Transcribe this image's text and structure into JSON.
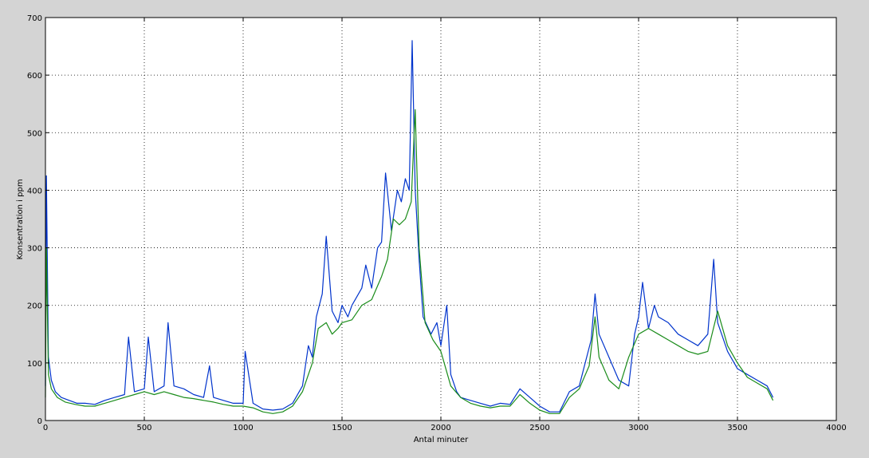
{
  "chart_data": {
    "type": "line",
    "title": "",
    "xlabel": "Antal minuter",
    "ylabel": "Konsentration i ppm",
    "xlim": [
      0,
      4000
    ],
    "ylim": [
      0,
      700
    ],
    "xticks": [
      0,
      500,
      1000,
      1500,
      2000,
      2500,
      3000,
      3500,
      4000
    ],
    "yticks": [
      0,
      100,
      200,
      300,
      400,
      500,
      600,
      700
    ],
    "grid": true,
    "legend": "none",
    "series": [
      {
        "color": "#0033cc",
        "x": [
          0,
          5,
          15,
          30,
          50,
          80,
          120,
          160,
          200,
          250,
          300,
          350,
          400,
          420,
          450,
          500,
          520,
          550,
          600,
          620,
          650,
          700,
          750,
          800,
          830,
          850,
          900,
          950,
          1000,
          1010,
          1050,
          1100,
          1150,
          1200,
          1250,
          1300,
          1330,
          1350,
          1370,
          1400,
          1420,
          1450,
          1480,
          1500,
          1530,
          1550,
          1600,
          1620,
          1650,
          1680,
          1700,
          1720,
          1750,
          1780,
          1800,
          1820,
          1840,
          1855,
          1870,
          1890,
          1910,
          1950,
          1980,
          2000,
          2030,
          2050,
          2080,
          2100,
          2150,
          2200,
          2250,
          2300,
          2350,
          2400,
          2450,
          2500,
          2550,
          2600,
          2650,
          2700,
          2730,
          2760,
          2780,
          2800,
          2850,
          2900,
          2950,
          2980,
          3000,
          3020,
          3050,
          3080,
          3100,
          3150,
          3200,
          3250,
          3300,
          3350,
          3380,
          3400,
          3450,
          3500,
          3550,
          3600,
          3650,
          3680
        ],
        "y": [
          60,
          425,
          110,
          70,
          50,
          40,
          35,
          30,
          30,
          28,
          35,
          40,
          45,
          145,
          50,
          55,
          145,
          50,
          60,
          170,
          60,
          55,
          45,
          40,
          95,
          40,
          35,
          30,
          30,
          120,
          30,
          20,
          18,
          20,
          30,
          60,
          130,
          110,
          180,
          220,
          320,
          190,
          170,
          200,
          180,
          200,
          230,
          270,
          230,
          300,
          310,
          430,
          330,
          400,
          380,
          420,
          400,
          660,
          400,
          280,
          180,
          150,
          170,
          130,
          200,
          80,
          50,
          40,
          35,
          30,
          25,
          30,
          28,
          55,
          40,
          25,
          15,
          15,
          50,
          60,
          100,
          140,
          220,
          150,
          110,
          70,
          60,
          150,
          180,
          240,
          160,
          200,
          180,
          170,
          150,
          140,
          130,
          150,
          280,
          170,
          120,
          90,
          80,
          70,
          60,
          40
        ]
      },
      {
        "color": "#1a8c1a",
        "x": [
          0,
          5,
          15,
          30,
          60,
          100,
          150,
          200,
          250,
          300,
          350,
          400,
          450,
          500,
          550,
          600,
          650,
          700,
          750,
          800,
          850,
          900,
          950,
          1000,
          1050,
          1100,
          1150,
          1200,
          1250,
          1300,
          1350,
          1380,
          1420,
          1450,
          1480,
          1500,
          1550,
          1600,
          1650,
          1700,
          1730,
          1760,
          1790,
          1820,
          1850,
          1870,
          1890,
          1920,
          1960,
          2000,
          2050,
          2100,
          2150,
          2200,
          2250,
          2300,
          2350,
          2400,
          2450,
          2500,
          2550,
          2600,
          2650,
          2700,
          2750,
          2780,
          2800,
          2850,
          2900,
          2950,
          3000,
          3050,
          3100,
          3150,
          3200,
          3250,
          3300,
          3350,
          3400,
          3450,
          3500,
          3550,
          3600,
          3650,
          3680
        ],
        "y": [
          40,
          300,
          80,
          55,
          40,
          32,
          28,
          25,
          25,
          30,
          35,
          40,
          45,
          50,
          45,
          50,
          45,
          40,
          38,
          35,
          32,
          28,
          25,
          25,
          22,
          15,
          12,
          15,
          25,
          50,
          100,
          160,
          170,
          150,
          160,
          170,
          175,
          200,
          210,
          250,
          280,
          350,
          340,
          350,
          380,
          540,
          300,
          170,
          140,
          120,
          60,
          40,
          30,
          25,
          22,
          25,
          25,
          45,
          30,
          18,
          12,
          12,
          40,
          55,
          95,
          180,
          110,
          70,
          55,
          110,
          150,
          160,
          150,
          140,
          130,
          120,
          115,
          120,
          190,
          130,
          100,
          75,
          65,
          55,
          35
        ]
      }
    ]
  }
}
